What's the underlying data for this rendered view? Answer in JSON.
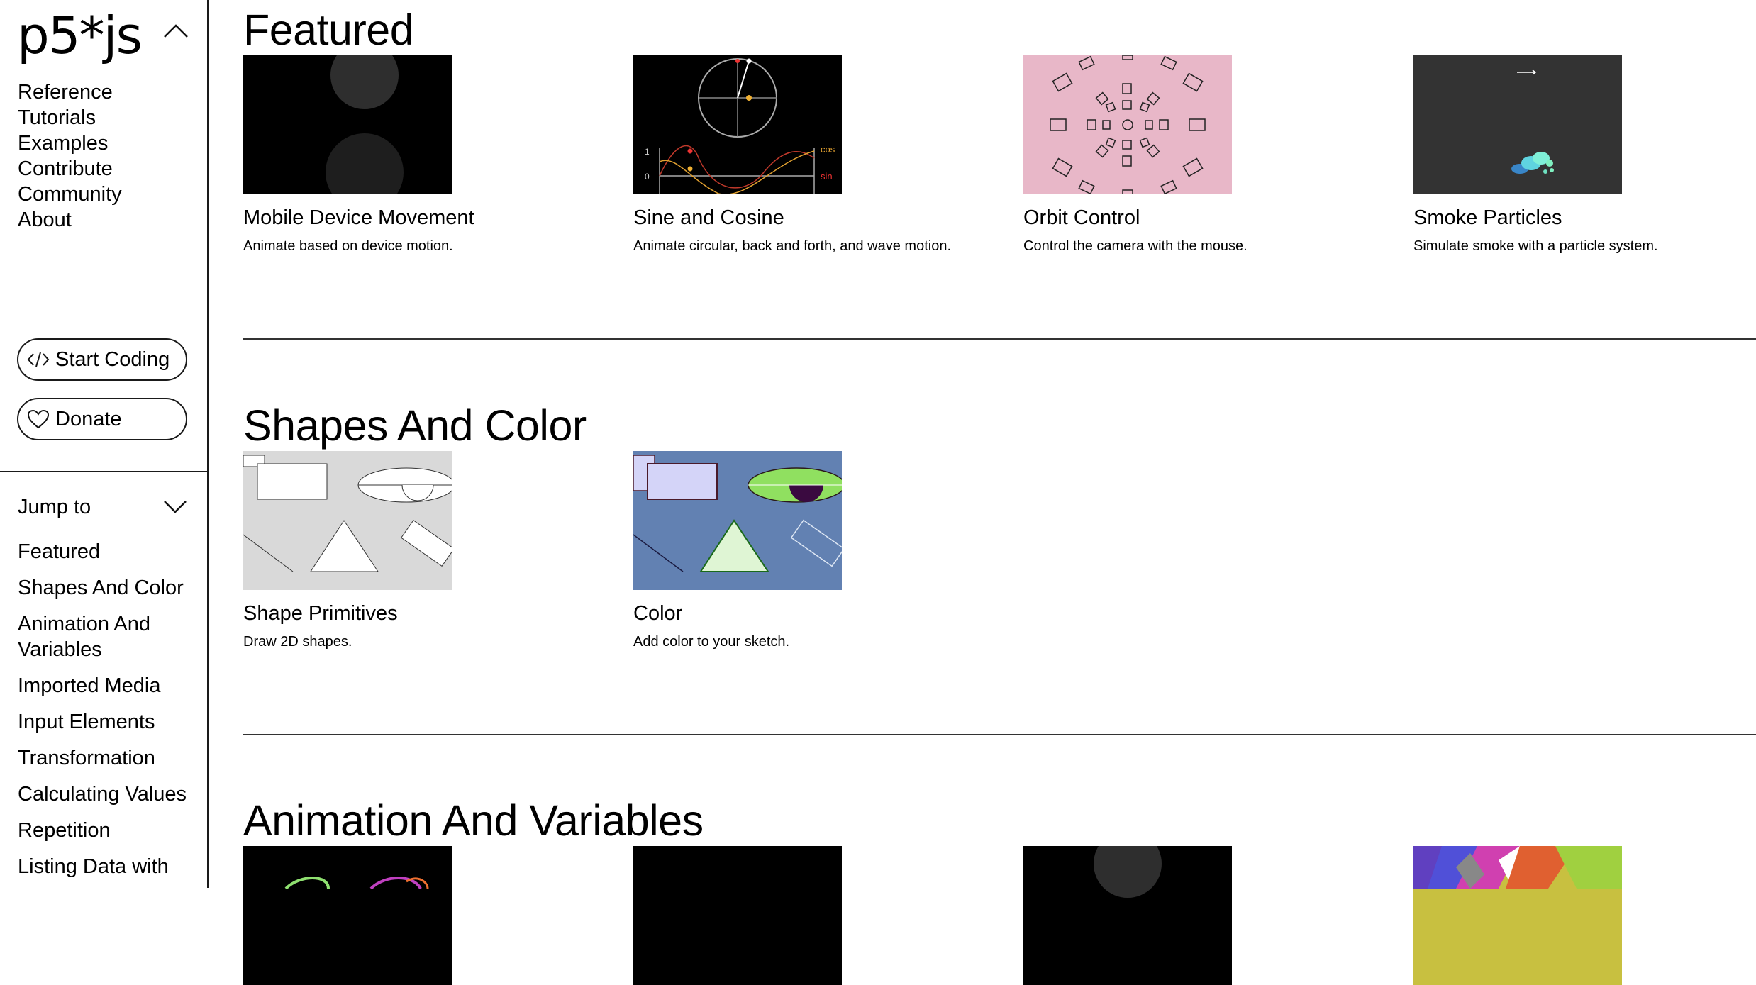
{
  "logo": "p5*js",
  "sidebar": {
    "nav": [
      "Reference",
      "Tutorials",
      "Examples",
      "Contribute",
      "Community",
      "About"
    ],
    "start_coding": "Start Coding",
    "donate": "Donate",
    "jump_to": "Jump to",
    "jump_links": [
      "Featured",
      "Shapes And Color",
      "Animation And Variables",
      "Imported Media",
      "Input Elements",
      "Transformation",
      "Calculating Values",
      "Repetition",
      "Listing Data with"
    ]
  },
  "sections": [
    {
      "title": "Featured",
      "cards": [
        {
          "title": "Mobile Device Movement",
          "desc": "Animate based on device motion."
        },
        {
          "title": "Sine and Cosine",
          "desc": "Animate circular, back and forth, and wave motion."
        },
        {
          "title": "Orbit Control",
          "desc": "Control the camera with the mouse."
        },
        {
          "title": "Smoke Particles",
          "desc": "Simulate smoke with a particle system."
        }
      ]
    },
    {
      "title": "Shapes And Color",
      "cards": [
        {
          "title": "Shape Primitives",
          "desc": "Draw 2D shapes."
        },
        {
          "title": "Color",
          "desc": "Add color to your sketch."
        }
      ]
    },
    {
      "title": "Animation And Variables",
      "cards": []
    }
  ],
  "thumb_labels": {
    "one": "1",
    "zero": "0",
    "cos": "cos",
    "sin": "sin"
  },
  "colors": {
    "orbit_bg": "#e8b7c8",
    "smoke_bg": "#333333",
    "color_bg": "#6281b2",
    "shapes_bg": "#d9d9d9"
  }
}
